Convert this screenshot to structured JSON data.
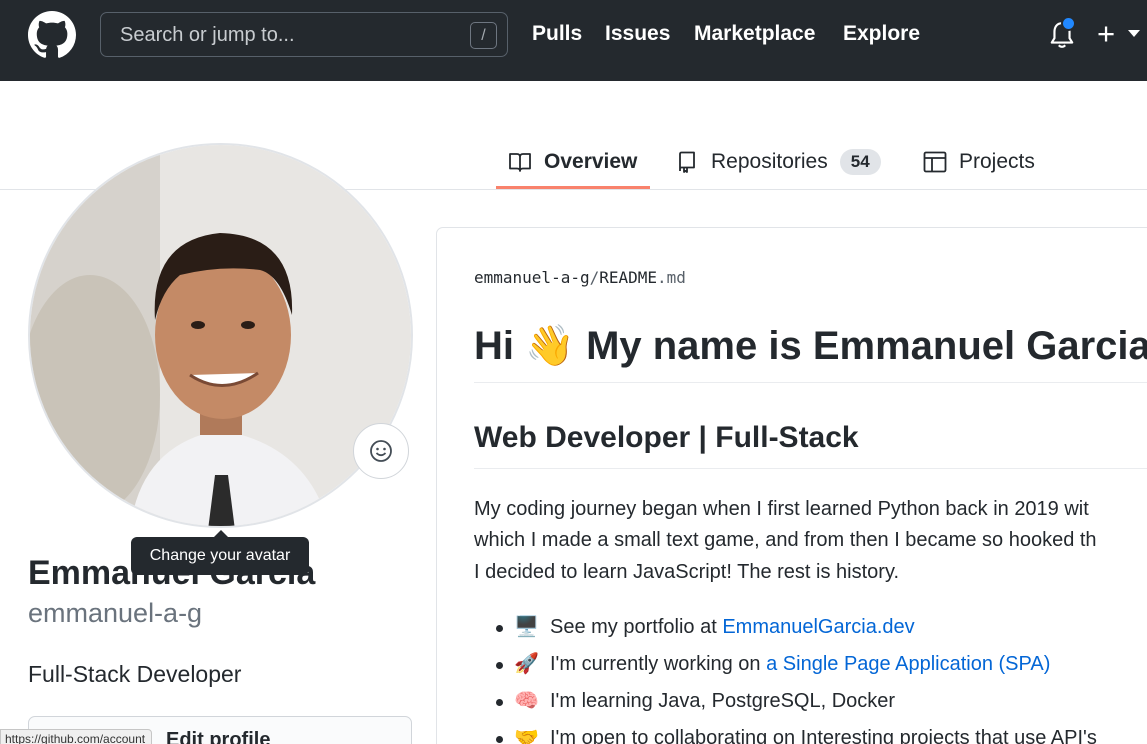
{
  "header": {
    "search_placeholder": "Search or jump to...",
    "search_key": "/",
    "nav": [
      "Pulls",
      "Issues",
      "Marketplace",
      "Explore"
    ],
    "new_symbol": "+"
  },
  "tabs": [
    {
      "label": "Overview",
      "icon": "book-icon",
      "active": true
    },
    {
      "label": "Repositories",
      "icon": "repo-icon",
      "count": "54"
    },
    {
      "label": "Projects",
      "icon": "project-icon"
    }
  ],
  "profile": {
    "tooltip": "Change your avatar",
    "fullname": "Emmanuel Garcia",
    "username": "emmanuel-a-g",
    "bio": "Full-Stack Developer",
    "edit_button": "Edit profile",
    "status_url": "https://github.com/account"
  },
  "readme": {
    "owner": "emmanuel-a-g",
    "separator": "/",
    "filename": "README",
    "ext": ".md",
    "title_pre": "Hi",
    "title_emoji": "👋",
    "title_post": "My name is Emmanuel Garcia",
    "subtitle": "Web Developer | Full-Stack",
    "para": [
      "My coding journey began when I first learned Python back in 2019 wit",
      "which I made a small text game, and from then I became so hooked th",
      "I decided to learn JavaScript! The rest is history."
    ],
    "list": [
      {
        "emoji": "🖥️",
        "text": "See my portfolio at ",
        "link": "EmmanuelGarcia.dev"
      },
      {
        "emoji": "🚀",
        "text": "I'm currently working on ",
        "link": "a Single Page Application (SPA)"
      },
      {
        "emoji": "🧠",
        "text": "I'm learning Java, PostgreSQL, Docker"
      },
      {
        "emoji": "🤝",
        "text": "I'm open to collaborating on Interesting projects that use API's"
      }
    ]
  },
  "colors": {
    "header_bg": "#24292e",
    "link": "#0366d6",
    "tab_accent": "#f9826c",
    "notification": "#2188ff"
  }
}
